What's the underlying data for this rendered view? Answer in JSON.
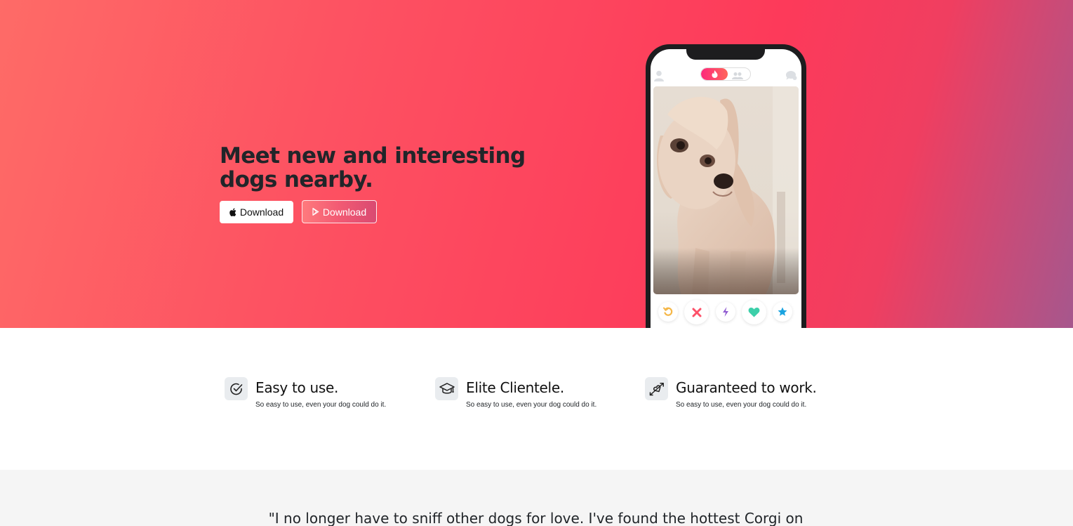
{
  "hero": {
    "title": "Meet new and interesting dogs nearby.",
    "apple_button_label": "Download",
    "play_button_label": "Download",
    "apple_icon": "apple-icon",
    "play_icon": "google-play-icon",
    "gradient_colors": [
      "#fe6b67",
      "#fd3a5a",
      "#a6578d"
    ]
  },
  "phone": {
    "top_icons": [
      "profile-icon",
      "flame-icon",
      "group-icon",
      "chat-icon"
    ],
    "actions": [
      "rewind-icon",
      "nope-icon",
      "boost-icon",
      "like-icon",
      "super-like-icon"
    ],
    "action_colors": [
      "#f5b748",
      "#fd5068",
      "#915dd1",
      "#3ccfa9",
      "#1aa3e0"
    ]
  },
  "features": [
    {
      "icon": "check-circle-icon",
      "title": "Easy to use.",
      "text": "So easy to use, even your dog could do it."
    },
    {
      "icon": "graduation-cap-icon",
      "title": "Elite Clientele.",
      "text": "So easy to use, even your dog could do it."
    },
    {
      "icon": "heart-arrow-icon",
      "title": "Guaranteed to work.",
      "text": "So easy to use, even your dog could do it."
    }
  ],
  "testimonial": {
    "quote": "\"I no longer have to sniff other dogs for love. I've found the hottest Corgi on"
  }
}
